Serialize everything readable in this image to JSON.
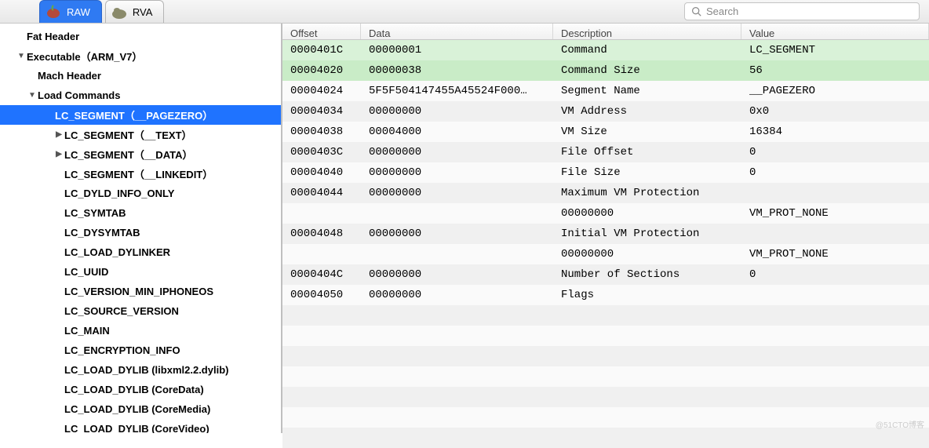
{
  "toolbar": {
    "tabs": [
      {
        "label": "RAW",
        "active": true
      },
      {
        "label": "RVA",
        "active": false
      }
    ],
    "search_placeholder": "Search"
  },
  "sidebar": [
    {
      "depth": 0,
      "arrow": "none",
      "bold": true,
      "sel": false,
      "label": "Fat Header"
    },
    {
      "depth": 1,
      "arrow": "down",
      "bold": true,
      "sel": false,
      "label": "Executable（ARM_V7）"
    },
    {
      "depth": 2,
      "arrow": "none",
      "bold": true,
      "sel": false,
      "label": "Mach Header"
    },
    {
      "depth": 2,
      "arrow": "down",
      "bold": true,
      "sel": false,
      "label": "Load Commands"
    },
    {
      "depth": 3,
      "arrow": "none",
      "bold": true,
      "sel": true,
      "label": "LC_SEGMENT（__PAGEZERO）"
    },
    {
      "depth": 4,
      "arrow": "right",
      "bold": true,
      "sel": false,
      "label": "LC_SEGMENT（__TEXT）"
    },
    {
      "depth": 4,
      "arrow": "right",
      "bold": true,
      "sel": false,
      "label": "LC_SEGMENT（__DATA）"
    },
    {
      "depth": 4,
      "arrow": "none",
      "bold": true,
      "sel": false,
      "label": "LC_SEGMENT（__LINKEDIT）"
    },
    {
      "depth": 4,
      "arrow": "none",
      "bold": true,
      "sel": false,
      "label": "LC_DYLD_INFO_ONLY"
    },
    {
      "depth": 4,
      "arrow": "none",
      "bold": true,
      "sel": false,
      "label": "LC_SYMTAB"
    },
    {
      "depth": 4,
      "arrow": "none",
      "bold": true,
      "sel": false,
      "label": "LC_DYSYMTAB"
    },
    {
      "depth": 4,
      "arrow": "none",
      "bold": true,
      "sel": false,
      "label": "LC_LOAD_DYLINKER"
    },
    {
      "depth": 4,
      "arrow": "none",
      "bold": true,
      "sel": false,
      "label": "LC_UUID"
    },
    {
      "depth": 4,
      "arrow": "none",
      "bold": true,
      "sel": false,
      "label": "LC_VERSION_MIN_IPHONEOS"
    },
    {
      "depth": 4,
      "arrow": "none",
      "bold": true,
      "sel": false,
      "label": "LC_SOURCE_VERSION"
    },
    {
      "depth": 4,
      "arrow": "none",
      "bold": true,
      "sel": false,
      "label": "LC_MAIN"
    },
    {
      "depth": 4,
      "arrow": "none",
      "bold": true,
      "sel": false,
      "label": "LC_ENCRYPTION_INFO"
    },
    {
      "depth": 4,
      "arrow": "none",
      "bold": true,
      "sel": false,
      "label": "LC_LOAD_DYLIB (libxml2.2.dylib)"
    },
    {
      "depth": 4,
      "arrow": "none",
      "bold": true,
      "sel": false,
      "label": "LC_LOAD_DYLIB (CoreData)"
    },
    {
      "depth": 4,
      "arrow": "none",
      "bold": true,
      "sel": false,
      "label": "LC_LOAD_DYLIB (CoreMedia)"
    },
    {
      "depth": 4,
      "arrow": "none",
      "bold": true,
      "sel": false,
      "label": "LC_LOAD_DYLIB (CoreVideo)"
    }
  ],
  "headers": {
    "offset": "Offset",
    "data": "Data",
    "description": "Description",
    "value": "Value"
  },
  "rows": [
    {
      "off": "0000401C",
      "data": "00000001",
      "desc": "Command",
      "val": "LC_SEGMENT",
      "hl": true
    },
    {
      "off": "00004020",
      "data": "00000038",
      "desc": "Command Size",
      "val": "56",
      "hl": true
    },
    {
      "off": "00004024",
      "data": "5F5F504147455A45524F000…",
      "desc": "Segment Name",
      "val": "__PAGEZERO",
      "hl": false
    },
    {
      "off": "00004034",
      "data": "00000000",
      "desc": "VM Address",
      "val": "0x0",
      "hl": false
    },
    {
      "off": "00004038",
      "data": "00004000",
      "desc": "VM Size",
      "val": "16384",
      "hl": false
    },
    {
      "off": "0000403C",
      "data": "00000000",
      "desc": "File Offset",
      "val": "0",
      "hl": false
    },
    {
      "off": "00004040",
      "data": "00000000",
      "desc": "File Size",
      "val": "0",
      "hl": false
    },
    {
      "off": "00004044",
      "data": "00000000",
      "desc": "Maximum VM Protection",
      "val": "",
      "hl": false
    },
    {
      "off": "",
      "data": "",
      "desc": "00000000",
      "val": "VM_PROT_NONE",
      "hl": false
    },
    {
      "off": "00004048",
      "data": "00000000",
      "desc": "Initial VM Protection",
      "val": "",
      "hl": false
    },
    {
      "off": "",
      "data": "",
      "desc": "00000000",
      "val": "VM_PROT_NONE",
      "hl": false
    },
    {
      "off": "0000404C",
      "data": "00000000",
      "desc": "Number of Sections",
      "val": "0",
      "hl": false
    },
    {
      "off": "00004050",
      "data": "00000000",
      "desc": "Flags",
      "val": "",
      "hl": false
    },
    {
      "off": "",
      "data": "",
      "desc": "",
      "val": "",
      "hl": false
    },
    {
      "off": "",
      "data": "",
      "desc": "",
      "val": "",
      "hl": false
    },
    {
      "off": "",
      "data": "",
      "desc": "",
      "val": "",
      "hl": false
    },
    {
      "off": "",
      "data": "",
      "desc": "",
      "val": "",
      "hl": false
    },
    {
      "off": "",
      "data": "",
      "desc": "",
      "val": "",
      "hl": false
    },
    {
      "off": "",
      "data": "",
      "desc": "",
      "val": "",
      "hl": false
    },
    {
      "off": "",
      "data": "",
      "desc": "",
      "val": "",
      "hl": false
    }
  ],
  "watermark": "@51CTO博客"
}
